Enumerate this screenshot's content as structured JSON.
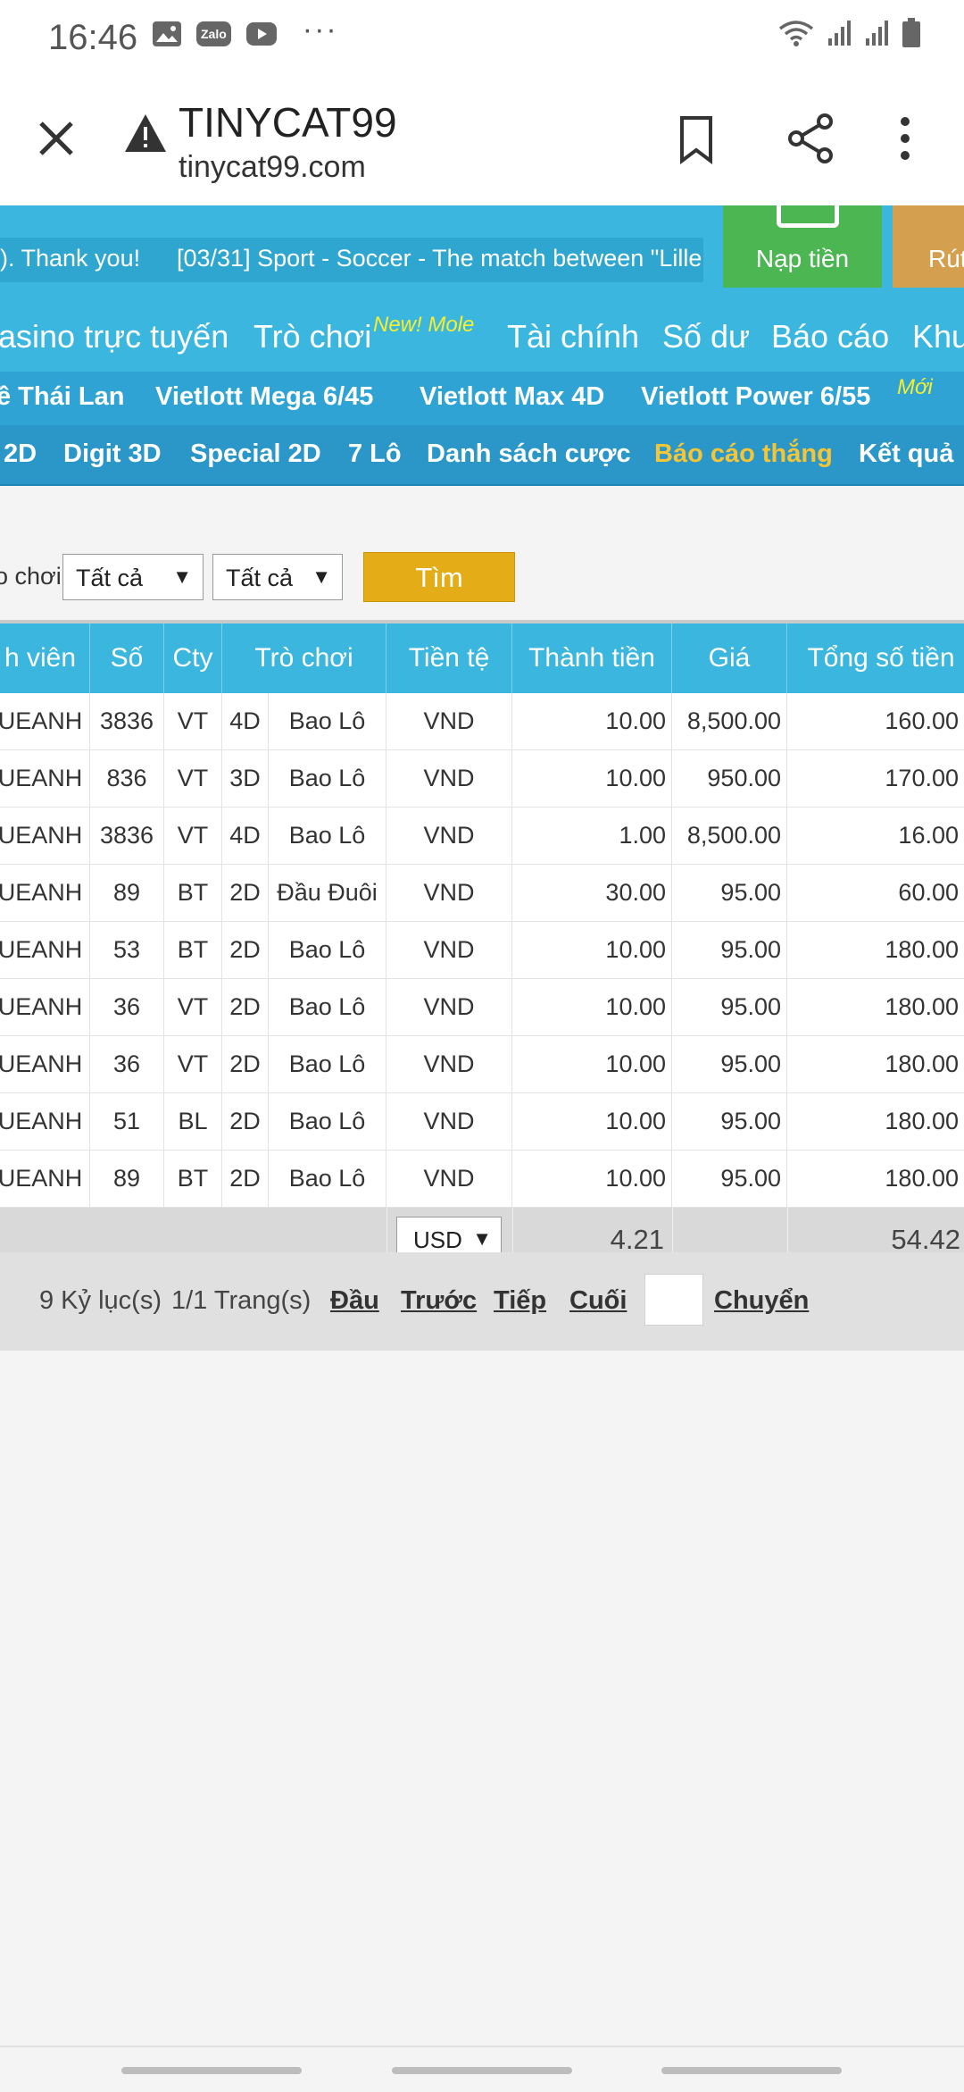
{
  "status_bar": {
    "time": "16:46",
    "more": "···",
    "zalo": "Zalo",
    "icons": [
      "gallery-icon",
      "zalo-icon",
      "youtube-icon",
      "wifi-icon",
      "signal-icon",
      "signal-icon",
      "battery-icon"
    ]
  },
  "browser": {
    "title": "TINYCAT99",
    "url": "tinycat99.com"
  },
  "ticker": {
    "text1": "). Thank you!",
    "text2": "[03/31] Sport - Soccer - The match between \"Lille"
  },
  "actions": {
    "deposit": "Nạp tiền",
    "withdraw": "Rút"
  },
  "nav1": {
    "casino": "asino trực tuyến",
    "games": "Trò chơi",
    "games_badge": "New! Mole",
    "finance": "Tài chính",
    "balance": "Số dư",
    "report": "Báo cáo",
    "more": "Khu"
  },
  "nav2": {
    "thai": "ề Thái Lan",
    "mega": "Vietlott Mega 6/45",
    "max4d": "Vietlott Max 4D",
    "power": "Vietlott Power 6/55",
    "power_badge": "Mới"
  },
  "nav3": {
    "d2": "2D",
    "digit3d": "Digit 3D",
    "special2d": "Special 2D",
    "lo7": "7 Lô",
    "bets": "Danh sách cược",
    "win_report": "Báo cáo thắng",
    "result": "Kết quả"
  },
  "filter": {
    "label": "o chơi",
    "select1": "Tất cả",
    "select2": "Tất cả",
    "search": "Tìm"
  },
  "table": {
    "headers": [
      "h viên",
      "Số",
      "Cty",
      "Trò chơi",
      "Tiền tệ",
      "Thành tiền",
      "Giá",
      "Tổng số tiền"
    ],
    "rows": [
      [
        "UEANH",
        "3836",
        "VT",
        "4D",
        "Bao Lô",
        "VND",
        "10.00",
        "8,500.00",
        "160.00"
      ],
      [
        "UEANH",
        "836",
        "VT",
        "3D",
        "Bao Lô",
        "VND",
        "10.00",
        "950.00",
        "170.00"
      ],
      [
        "UEANH",
        "3836",
        "VT",
        "4D",
        "Bao Lô",
        "VND",
        "1.00",
        "8,500.00",
        "16.00"
      ],
      [
        "UEANH",
        "89",
        "BT",
        "2D",
        "Đầu Đuôi",
        "VND",
        "30.00",
        "95.00",
        "60.00"
      ],
      [
        "UEANH",
        "53",
        "BT",
        "2D",
        "Bao Lô",
        "VND",
        "10.00",
        "95.00",
        "180.00"
      ],
      [
        "UEANH",
        "36",
        "VT",
        "2D",
        "Bao Lô",
        "VND",
        "10.00",
        "95.00",
        "180.00"
      ],
      [
        "UEANH",
        "36",
        "VT",
        "2D",
        "Bao Lô",
        "VND",
        "10.00",
        "95.00",
        "180.00"
      ],
      [
        "UEANH",
        "51",
        "BL",
        "2D",
        "Bao Lô",
        "VND",
        "10.00",
        "95.00",
        "180.00"
      ],
      [
        "UEANH",
        "89",
        "BT",
        "2D",
        "Bao Lô",
        "VND",
        "10.00",
        "95.00",
        "180.00"
      ]
    ],
    "summary": {
      "currency": "USD",
      "amount": "4.21",
      "total": "54.42"
    }
  },
  "pager": {
    "records": "9 Kỷ lục(s)",
    "pages": "1/1 Trang(s)",
    "first": "Đầu",
    "prev": "Trước",
    "next": "Tiếp",
    "last": "Cuối",
    "go": "Chuyển"
  },
  "colors": {
    "header_blue": "#3bb6df",
    "nav_dark": "#2a97c8",
    "deposit_green": "#4cb652",
    "withdraw_orange": "#d4a050",
    "search_gold": "#e4ad17",
    "active_link": "#f5c538",
    "badge_yellow": "#f7ef2d"
  }
}
